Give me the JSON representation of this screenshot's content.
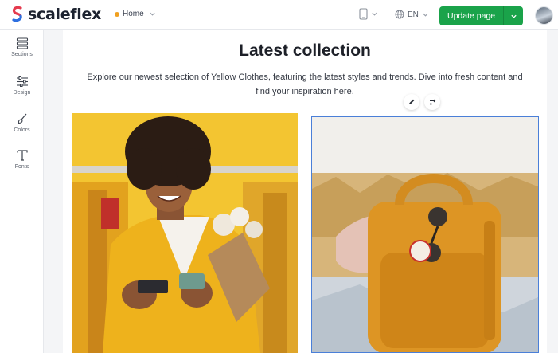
{
  "header": {
    "logo_text": "scaleflex",
    "page_select": "Home",
    "language": "EN",
    "update_button": "Update page"
  },
  "sidebar": {
    "items": [
      {
        "label": "Sections",
        "icon": "sections-icon"
      },
      {
        "label": "Design",
        "icon": "sliders-icon"
      },
      {
        "label": "Colors",
        "icon": "brush-icon"
      },
      {
        "label": "Fonts",
        "icon": "text-font-icon"
      }
    ]
  },
  "content": {
    "title": "Latest collection",
    "description": "Explore our newest selection of Yellow Clothes, featuring the latest styles and trends. Dive into fresh content and find your inspiration here."
  },
  "colors": {
    "accent_green": "#1aa34a",
    "selection_blue": "#4a7fd8",
    "page_dot": "#f0a020"
  }
}
